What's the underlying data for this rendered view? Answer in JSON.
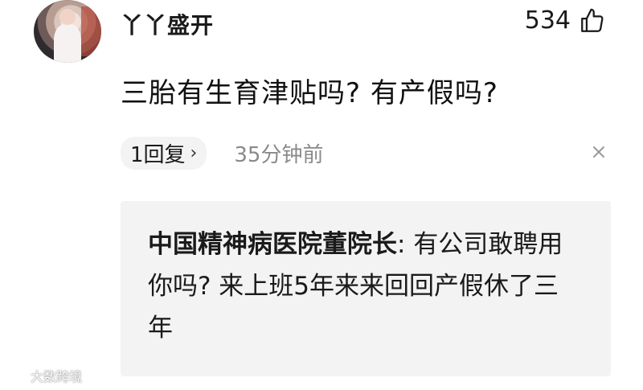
{
  "comment": {
    "username": "丫丫盛开",
    "like_count": "534",
    "text": "三胎有生育津贴吗? 有产假吗?",
    "reply_count_label": "1回复",
    "reply_chevron": "›",
    "timestamp": "35分钟前",
    "close_glyph": "×"
  },
  "reply": {
    "author": "中国精神病医院董院长",
    "separator": ": ",
    "text": "有公司敢聘用你吗? 来上班5年来来回回产假休了三年"
  },
  "watermark": {
    "text": "大数跨境"
  },
  "colors": {
    "reply_bg": "#f3f3f3",
    "timestamp": "#8a8a8a",
    "text": "#1a1a1a"
  },
  "icons": {
    "like": "thumbs-up-icon",
    "close": "close-icon",
    "chevron": "chevron-right-icon"
  }
}
